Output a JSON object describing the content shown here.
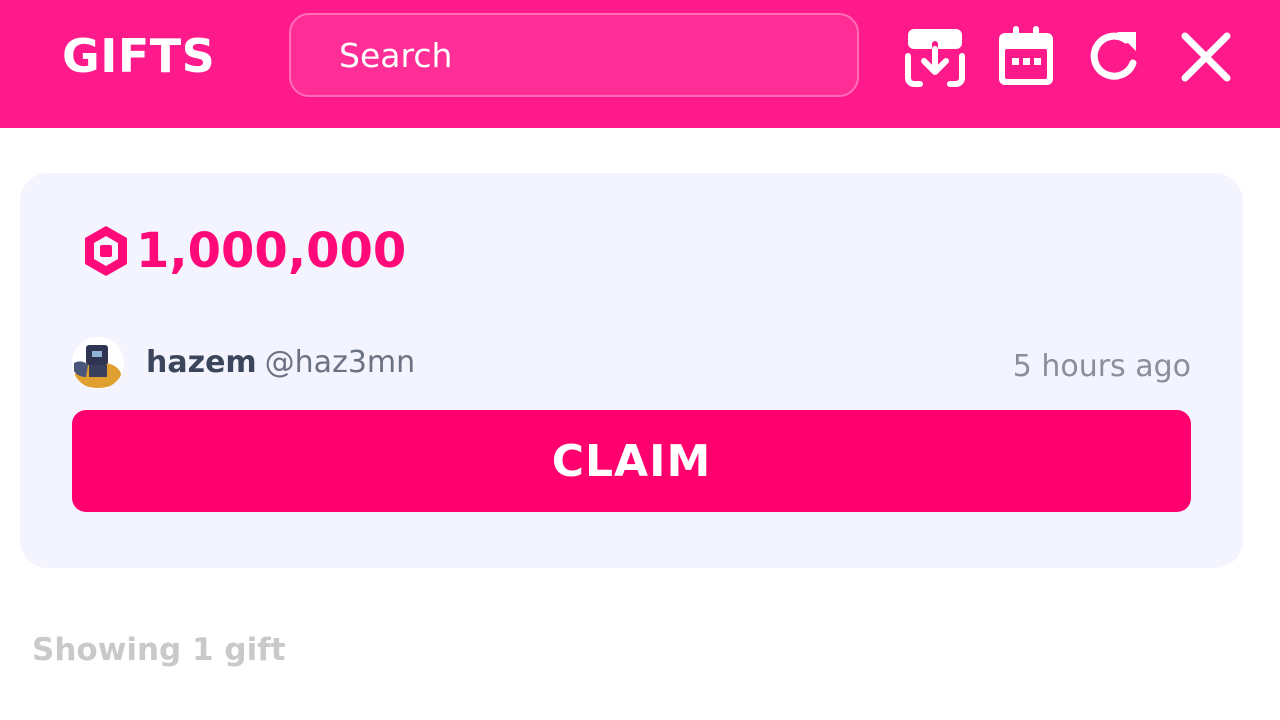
{
  "header": {
    "title": "GIFTS",
    "search_placeholder": "Search",
    "icons": [
      "download-icon",
      "calendar-icon",
      "refresh-icon",
      "close-icon"
    ],
    "background_color": "#ff1a8c"
  },
  "gift": {
    "currency_icon": "robux-icon",
    "amount": "1,000,000",
    "amount_color": "#ff0a78",
    "sender_name": "hazem",
    "sender_handle": "@haz3mn",
    "time_ago": "5 hours ago",
    "claim_label": "CLAIM",
    "claim_color": "#ff006e"
  },
  "footer": {
    "count_text": "Showing 1 gift"
  }
}
